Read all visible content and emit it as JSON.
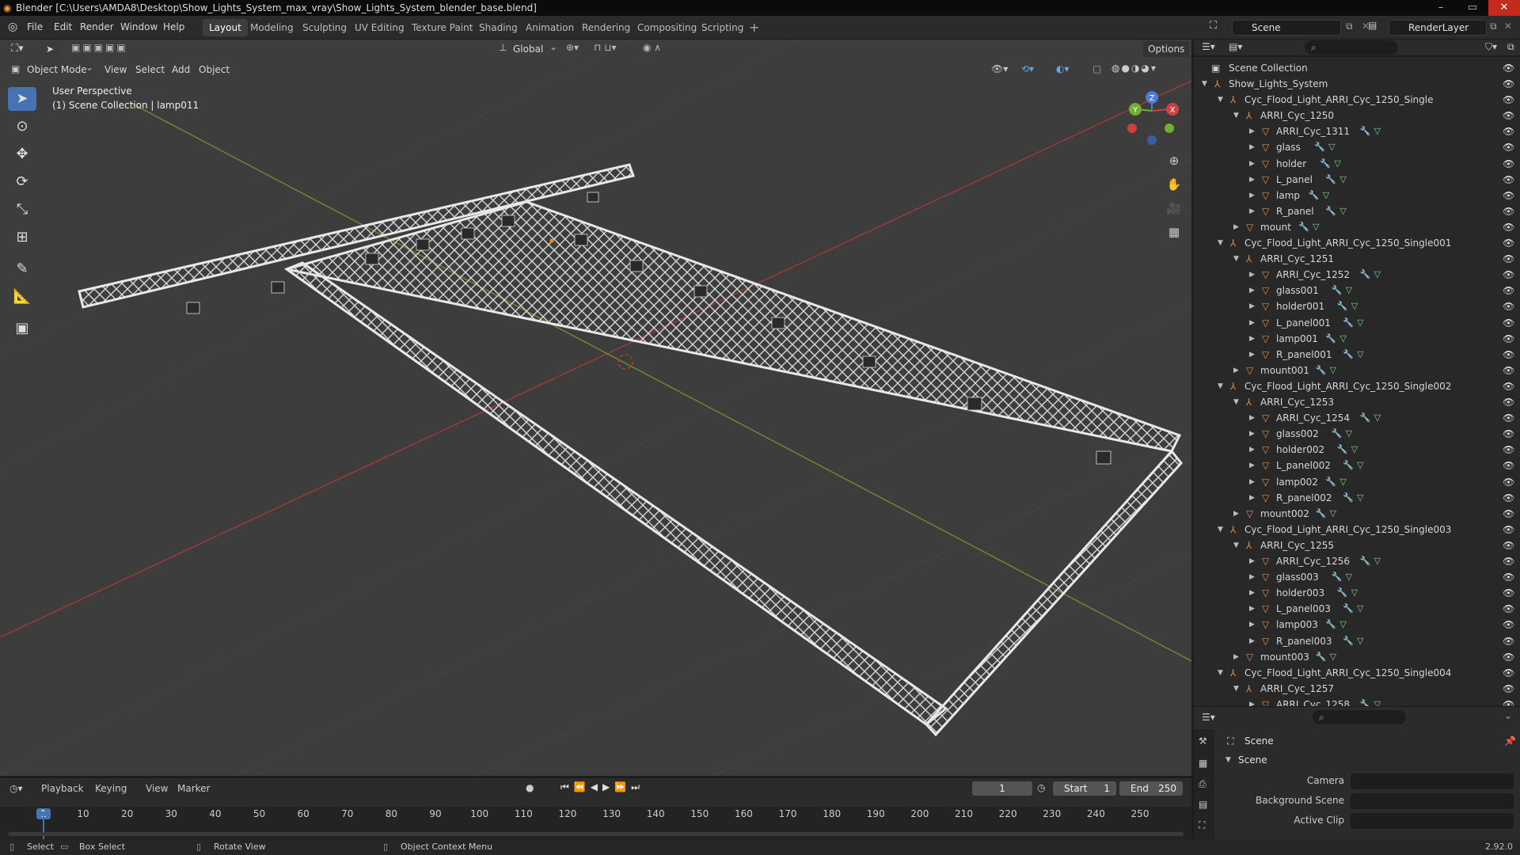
{
  "window": {
    "title": "Blender [C:\\Users\\AMDA8\\Desktop\\Show_Lights_System_max_vray\\Show_Lights_System_blender_base.blend]"
  },
  "menus": [
    "File",
    "Edit",
    "Render",
    "Window",
    "Help"
  ],
  "workspaces": [
    "Layout",
    "Modeling",
    "Sculpting",
    "UV Editing",
    "Texture Paint",
    "Shading",
    "Animation",
    "Rendering",
    "Compositing",
    "Scripting"
  ],
  "active_workspace": "Layout",
  "scene_field": "Scene",
  "layer_field": "RenderLayer",
  "viewport": {
    "transform_orientation": "Global",
    "options": "Options",
    "mode": "Object Mode",
    "header_menus": [
      "View",
      "Select",
      "Add",
      "Object"
    ],
    "info_line1": "User Perspective",
    "info_line2": "(1) Scene Collection | lamp011",
    "gizmo": {
      "x": "X",
      "y": "Y",
      "z": "Z"
    }
  },
  "outliner": {
    "root": "Scene Collection",
    "rows": [
      {
        "label": "Show_Lights_System",
        "level": 0,
        "kind": "empty",
        "open": true,
        "extras": false
      },
      {
        "label": "Cyc_Flood_Light_ARRI_Cyc_1250_Single",
        "level": 1,
        "kind": "empty",
        "open": true,
        "extras": false
      },
      {
        "label": "ARRI_Cyc_1250",
        "level": 2,
        "kind": "empty",
        "open": true,
        "extras": false
      },
      {
        "label": "ARRI_Cyc_1311",
        "level": 3,
        "kind": "mesh",
        "open": false,
        "extras": true
      },
      {
        "label": "glass",
        "level": 3,
        "kind": "mesh",
        "open": false,
        "extras": true
      },
      {
        "label": "holder",
        "level": 3,
        "kind": "mesh",
        "open": false,
        "extras": true
      },
      {
        "label": "L_panel",
        "level": 3,
        "kind": "mesh",
        "open": false,
        "extras": true
      },
      {
        "label": "lamp",
        "level": 3,
        "kind": "mesh",
        "open": false,
        "extras": true
      },
      {
        "label": "R_panel",
        "level": 3,
        "kind": "mesh",
        "open": false,
        "extras": true
      },
      {
        "label": "mount",
        "level": 2,
        "kind": "mesh",
        "open": false,
        "extras": true
      },
      {
        "label": "Cyc_Flood_Light_ARRI_Cyc_1250_Single001",
        "level": 1,
        "kind": "empty",
        "open": true,
        "extras": false
      },
      {
        "label": "ARRI_Cyc_1251",
        "level": 2,
        "kind": "empty",
        "open": true,
        "extras": false
      },
      {
        "label": "ARRI_Cyc_1252",
        "level": 3,
        "kind": "mesh",
        "open": false,
        "extras": true
      },
      {
        "label": "glass001",
        "level": 3,
        "kind": "mesh",
        "open": false,
        "extras": true
      },
      {
        "label": "holder001",
        "level": 3,
        "kind": "mesh",
        "open": false,
        "extras": true
      },
      {
        "label": "L_panel001",
        "level": 3,
        "kind": "mesh",
        "open": false,
        "extras": true
      },
      {
        "label": "lamp001",
        "level": 3,
        "kind": "mesh",
        "open": false,
        "extras": true
      },
      {
        "label": "R_panel001",
        "level": 3,
        "kind": "mesh",
        "open": false,
        "extras": true
      },
      {
        "label": "mount001",
        "level": 2,
        "kind": "mesh",
        "open": false,
        "extras": true
      },
      {
        "label": "Cyc_Flood_Light_ARRI_Cyc_1250_Single002",
        "level": 1,
        "kind": "empty",
        "open": true,
        "extras": false
      },
      {
        "label": "ARRI_Cyc_1253",
        "level": 2,
        "kind": "empty",
        "open": true,
        "extras": false
      },
      {
        "label": "ARRI_Cyc_1254",
        "level": 3,
        "kind": "mesh",
        "open": false,
        "extras": true
      },
      {
        "label": "glass002",
        "level": 3,
        "kind": "mesh",
        "open": false,
        "extras": true
      },
      {
        "label": "holder002",
        "level": 3,
        "kind": "mesh",
        "open": false,
        "extras": true
      },
      {
        "label": "L_panel002",
        "level": 3,
        "kind": "mesh",
        "open": false,
        "extras": true
      },
      {
        "label": "lamp002",
        "level": 3,
        "kind": "mesh",
        "open": false,
        "extras": true
      },
      {
        "label": "R_panel002",
        "level": 3,
        "kind": "mesh",
        "open": false,
        "extras": true
      },
      {
        "label": "mount002",
        "level": 2,
        "kind": "mesh",
        "open": false,
        "extras": true
      },
      {
        "label": "Cyc_Flood_Light_ARRI_Cyc_1250_Single003",
        "level": 1,
        "kind": "empty",
        "open": true,
        "extras": false
      },
      {
        "label": "ARRI_Cyc_1255",
        "level": 2,
        "kind": "empty",
        "open": true,
        "extras": false
      },
      {
        "label": "ARRI_Cyc_1256",
        "level": 3,
        "kind": "mesh",
        "open": false,
        "extras": true
      },
      {
        "label": "glass003",
        "level": 3,
        "kind": "mesh",
        "open": false,
        "extras": true
      },
      {
        "label": "holder003",
        "level": 3,
        "kind": "mesh",
        "open": false,
        "extras": true
      },
      {
        "label": "L_panel003",
        "level": 3,
        "kind": "mesh",
        "open": false,
        "extras": true
      },
      {
        "label": "lamp003",
        "level": 3,
        "kind": "mesh",
        "open": false,
        "extras": true
      },
      {
        "label": "R_panel003",
        "level": 3,
        "kind": "mesh",
        "open": false,
        "extras": true
      },
      {
        "label": "mount003",
        "level": 2,
        "kind": "mesh",
        "open": false,
        "extras": true
      },
      {
        "label": "Cyc_Flood_Light_ARRI_Cyc_1250_Single004",
        "level": 1,
        "kind": "empty",
        "open": true,
        "extras": false
      },
      {
        "label": "ARRI_Cyc_1257",
        "level": 2,
        "kind": "empty",
        "open": true,
        "extras": false
      },
      {
        "label": "ARRI_Cyc_1258",
        "level": 3,
        "kind": "mesh",
        "open": false,
        "extras": true
      }
    ]
  },
  "properties": {
    "header": "Scene",
    "section": "Scene",
    "fields": [
      {
        "label": "Camera",
        "value": ""
      },
      {
        "label": "Background Scene",
        "value": ""
      },
      {
        "label": "Active Clip",
        "value": ""
      }
    ]
  },
  "timeline": {
    "menus": [
      "Playback",
      "Keying",
      "View",
      "Marker"
    ],
    "current_frame": "1",
    "start_label": "Start",
    "start": "1",
    "end_label": "End",
    "end": "250",
    "ticks": [
      "1",
      "10",
      "20",
      "30",
      "40",
      "50",
      "60",
      "70",
      "80",
      "90",
      "100",
      "110",
      "120",
      "130",
      "140",
      "150",
      "160",
      "170",
      "180",
      "190",
      "200",
      "210",
      "220",
      "230",
      "240",
      "250"
    ]
  },
  "status": {
    "items": [
      "Select",
      "Box Select",
      "Rotate View",
      "Object Context Menu"
    ],
    "version": "2.92.0"
  },
  "colors": {
    "accent": "#4772b3",
    "mesh_icon": "#e58a45",
    "empty_icon": "#e58a45",
    "modifier_icon": "#6aa8e0",
    "data_icon": "#7dd67d"
  }
}
